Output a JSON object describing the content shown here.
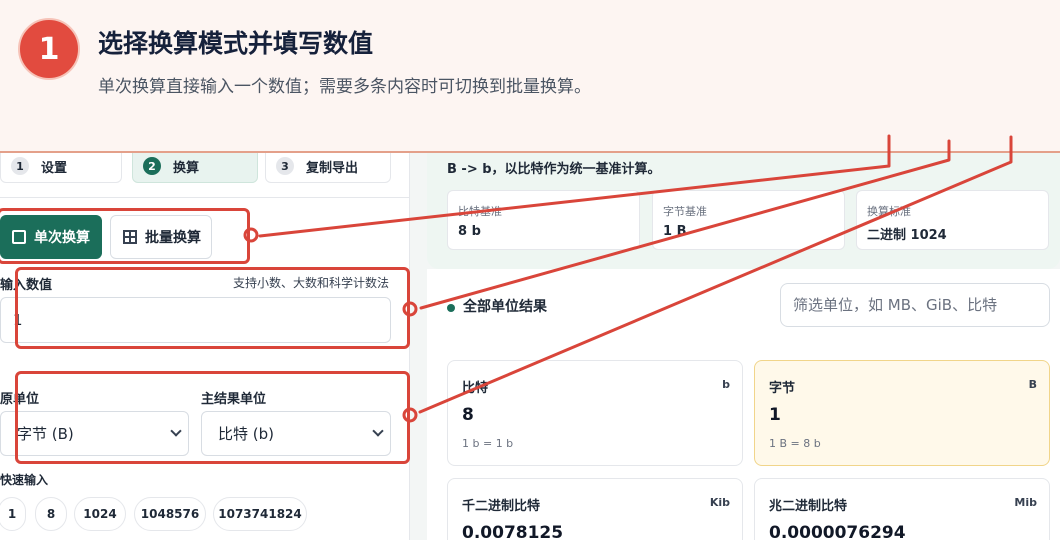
{
  "banner": {
    "step_number": "1",
    "title": "选择换算模式并填写数值",
    "description": "单次换算直接输入一个数值；需要多条内容时可切换到批量换算。"
  },
  "steps": [
    {
      "num": "1",
      "label": "设置"
    },
    {
      "num": "2",
      "label": "换算"
    },
    {
      "num": "3",
      "label": "复制导出"
    }
  ],
  "modes": {
    "single": "单次换算",
    "batch": "批量换算"
  },
  "input": {
    "label": "输入数值",
    "hint": "支持小数、大数和科学计数法",
    "value": "1"
  },
  "source_unit": {
    "label": "原单位",
    "value": "字节 (B)"
  },
  "result_unit": {
    "label": "主结果单位",
    "value": "比特 (b)"
  },
  "quick": {
    "label": "快速输入",
    "values": [
      "1",
      "8",
      "1024",
      "1048576",
      "1073741824"
    ]
  },
  "summary": {
    "line": "B -> b，以比特作为统一基准计算。",
    "stats": [
      {
        "label": "比特基准",
        "value": "8 b"
      },
      {
        "label": "字节基准",
        "value": "1 B"
      },
      {
        "label": "换算标准",
        "value": "二进制 1024"
      }
    ]
  },
  "results": {
    "title": "全部单位结果",
    "filter_placeholder": "筛选单位，如 MB、GiB、比特",
    "units": [
      {
        "name": "比特",
        "symbol": "b",
        "value": "8",
        "relation": "1 b = 1 b"
      },
      {
        "name": "字节",
        "symbol": "B",
        "value": "1",
        "relation": "1 B = 8 b"
      },
      {
        "name": "千二进制比特",
        "symbol": "Kib",
        "value": "0.0078125",
        "relation": ""
      },
      {
        "name": "兆二进制比特",
        "symbol": "Mib",
        "value": "0.0000076294",
        "relation": ""
      }
    ]
  },
  "colors": {
    "accent": "#1b6e5a",
    "annotation": "#d9453a",
    "highlight": "#fff9ea"
  }
}
